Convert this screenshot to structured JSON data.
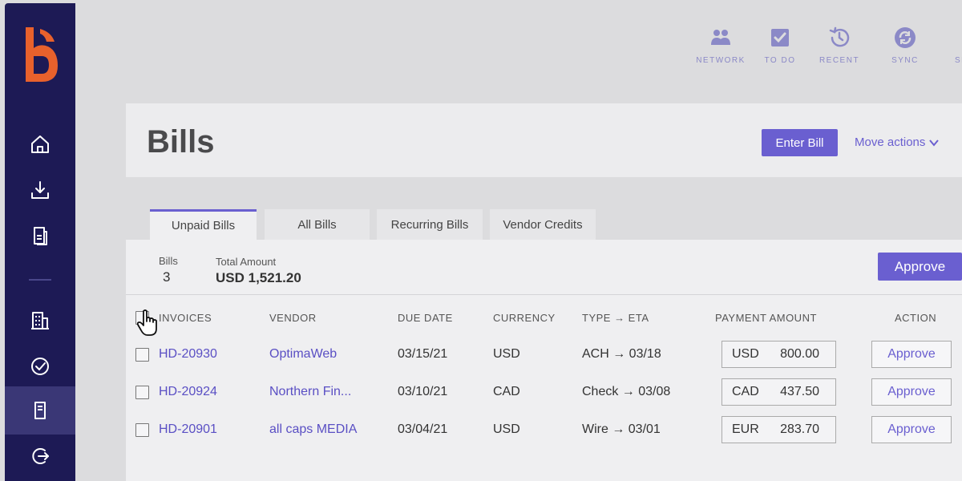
{
  "topbar": [
    {
      "name": "network",
      "label": "NETWORK",
      "icon": "people-icon"
    },
    {
      "name": "todo",
      "label": "TO DO",
      "icon": "checkbox-icon"
    },
    {
      "name": "recent",
      "label": "RECENT",
      "icon": "history-icon"
    },
    {
      "name": "sync",
      "label": "SYNC",
      "icon": "sync-icon"
    },
    {
      "name": "settings",
      "label": "SET",
      "icon": "settings-icon"
    }
  ],
  "sidebar": {
    "logo": "bill-logo",
    "items": [
      {
        "name": "home",
        "icon": "home-icon"
      },
      {
        "name": "receivables",
        "icon": "download-icon"
      },
      {
        "name": "documents",
        "icon": "document-icon"
      },
      {
        "name": "company",
        "icon": "building-icon"
      },
      {
        "name": "approvals",
        "icon": "check-circle-icon"
      },
      {
        "name": "bills",
        "icon": "bill-icon",
        "active": true
      },
      {
        "name": "logout",
        "icon": "logout-icon"
      }
    ]
  },
  "header": {
    "title": "Bills",
    "enter_bill": "Enter Bill",
    "move_actions": "Move actions"
  },
  "tabs": [
    {
      "label": "Unpaid Bills",
      "active": true
    },
    {
      "label": "All Bills"
    },
    {
      "label": "Recurring Bills"
    },
    {
      "label": "Vendor Credits"
    }
  ],
  "summary": {
    "bills_label": "Bills",
    "bills_count": "3",
    "total_label": "Total Amount",
    "total_value": "USD 1,521.20",
    "approve": "Approve"
  },
  "table": {
    "headers": [
      "INVOICES",
      "VENDOR",
      "DUE DATE",
      "CURRENCY",
      "TYPE → ETA",
      "PAYMENT AMOUNT",
      "ACTION"
    ],
    "rows": [
      {
        "invoice": "HD-20930",
        "vendor": "OptimaWeb",
        "due_date": "03/15/21",
        "currency": "USD",
        "type_eta": "ACH → 03/18",
        "pay_currency": "USD",
        "pay_amount": "800.00",
        "action": "Approve"
      },
      {
        "invoice": "HD-20924",
        "vendor": "Northern Fin...",
        "due_date": "03/10/21",
        "currency": "CAD",
        "type_eta": "Check → 03/08",
        "pay_currency": "CAD",
        "pay_amount": "437.50",
        "action": "Approve"
      },
      {
        "invoice": "HD-20901",
        "vendor": "all caps MEDIA",
        "due_date": "03/04/21",
        "currency": "USD",
        "type_eta": "Wire → 03/01",
        "pay_currency": "EUR",
        "pay_amount": "283.70",
        "action": "Approve"
      }
    ]
  },
  "colors": {
    "sidebar": "#1d1a55",
    "accent": "#6a5fd0",
    "logo": "#e8612c"
  }
}
